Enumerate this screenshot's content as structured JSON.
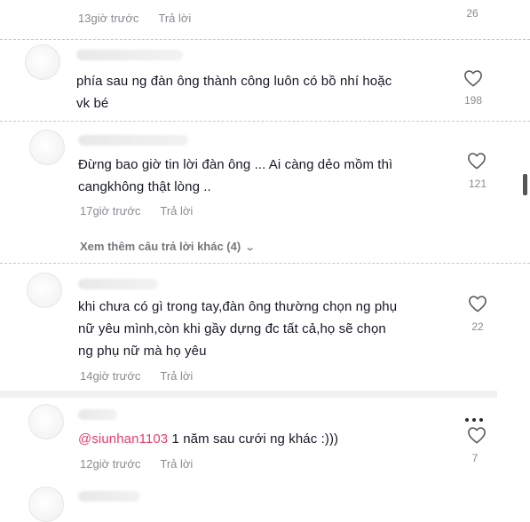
{
  "comments": [
    {
      "time": "13giờ trước",
      "reply_label": "Trả lời",
      "likes": "26"
    },
    {
      "text_line1": "phía sau ng đàn ông thành công luôn có bồ nhí hoặc",
      "text_line2": "vk bé",
      "likes": "198"
    },
    {
      "text_line1": "Đừng bao giờ tin lời đàn ông ... Ai càng dẻo mồm thì",
      "text_line2": "cangkhông thật lòng ..",
      "time": "17giờ trước",
      "reply_label": "Trả lời",
      "likes": "121"
    },
    {
      "text_line1": "khi chưa có gì trong tay,đàn ông thường chọn ng phụ",
      "text_line2": "nữ yêu mình,còn khi gầy dựng đc tất cả,họ sẽ chọn",
      "text_line3": "ng phụ nữ mà họ yêu",
      "time": "14giờ trước",
      "reply_label": "Trả lời",
      "likes": "22"
    },
    {
      "mention": "@siunhan1103",
      "text": " 1 năm sau cưới ng khác :)))",
      "time": "12giờ trước",
      "reply_label": "Trả lời",
      "likes": "7"
    }
  ],
  "more_replies": "Xem thêm câu trả lời khác (4)",
  "colors": {
    "text": "#161823",
    "meta": "#8a8b91",
    "mention": "#e83e6a",
    "band": "#f1f1f2"
  },
  "icons": {
    "like": "heart-outline-icon",
    "options": "more-dots-icon",
    "expand": "chevron-down-icon"
  }
}
